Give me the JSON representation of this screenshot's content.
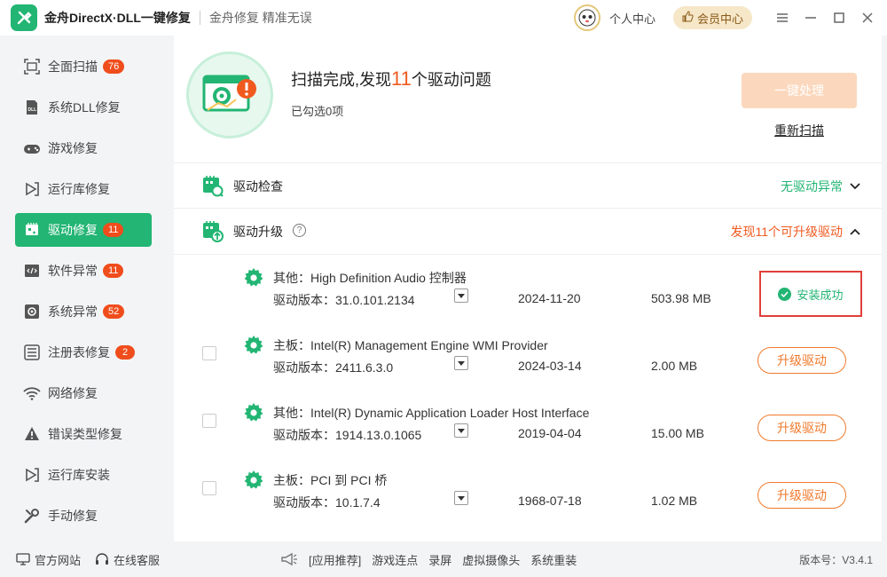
{
  "app": {
    "title": "金舟DirectX·DLL一键修复",
    "slogan": "金舟修复 精准无误",
    "personal_center": "个人中心",
    "vip_center": "会员中心"
  },
  "sidebar": {
    "items": [
      {
        "label": "全面扫描",
        "badge": "76"
      },
      {
        "label": "系统DLL修复",
        "badge": ""
      },
      {
        "label": "游戏修复",
        "badge": ""
      },
      {
        "label": "运行库修复",
        "badge": ""
      },
      {
        "label": "驱动修复",
        "badge": "11"
      },
      {
        "label": "软件异常",
        "badge": "11"
      },
      {
        "label": "系统异常",
        "badge": "52"
      },
      {
        "label": "注册表修复",
        "badge": "2"
      },
      {
        "label": "网络修复",
        "badge": ""
      },
      {
        "label": "错误类型修复",
        "badge": ""
      },
      {
        "label": "运行库安装",
        "badge": ""
      },
      {
        "label": "手动修复",
        "badge": ""
      }
    ]
  },
  "summary": {
    "title_prefix": "扫描完成,发现",
    "count": "11",
    "title_suffix": "个驱动问题",
    "selected": "已勾选0项",
    "fix_button": "一键处理",
    "rescan": "重新扫描"
  },
  "sections": {
    "check": {
      "label": "驱动检查",
      "status": "无驱动异常"
    },
    "upgrade": {
      "label": "驱动升级",
      "status": "发现11个可升级驱动"
    }
  },
  "drivers": [
    {
      "name": "其他：High Definition Audio 控制器",
      "version": "驱动版本：31.0.101.2134",
      "date": "2024-11-20",
      "size": "503.98 MB",
      "action": "安装成功"
    },
    {
      "name": "主板：Intel(R) Management Engine WMI Provider",
      "version": "驱动版本：2411.6.3.0",
      "date": "2024-03-14",
      "size": "2.00 MB",
      "action": "升级驱动"
    },
    {
      "name": "其他：Intel(R) Dynamic Application Loader Host Interface",
      "version": "驱动版本：1914.13.0.1065",
      "date": "2019-04-04",
      "size": "15.00 MB",
      "action": "升级驱动"
    },
    {
      "name": "主板：PCI 到 PCI 桥",
      "version": "驱动版本：10.1.7.4",
      "date": "1968-07-18",
      "size": "1.02 MB",
      "action": "升级驱动"
    }
  ],
  "footer": {
    "website": "官方网站",
    "service": "在线客服",
    "recommend": "[应用推荐]",
    "links": [
      "游戏连点",
      "录屏",
      "虚拟摄像头",
      "系统重装"
    ],
    "version": "版本号：V3.4.1"
  },
  "colors": {
    "brand_green": "#22b573",
    "badge_red": "#f04d1c",
    "accent_orange": "#f07a2c",
    "highlight_red": "#e0403a"
  }
}
